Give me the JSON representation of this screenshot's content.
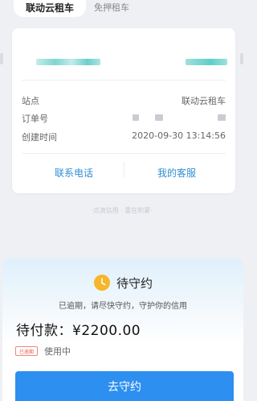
{
  "tabs": [
    {
      "label": "联动云租车"
    },
    {
      "label": "免押租车"
    }
  ],
  "order": {
    "rows": [
      {
        "label": "站点",
        "value": "联动云租车"
      },
      {
        "label": "订单号",
        "value": ""
      },
      {
        "label": "创建时间",
        "value": "2020-09-30 13:14:56"
      }
    ],
    "contact_label": "联系电话",
    "service_label": "我的客服"
  },
  "watermark": "·点滴信用 · 重在积累·",
  "pending": {
    "title": "待守约",
    "subtitle": "已逾期，请尽快守约，守护你的信用",
    "amount_label": "待付款：",
    "amount_value": "¥2200.00",
    "badge": "已逾期",
    "status": "使用中",
    "cta_label": "去守约"
  },
  "colors": {
    "accent": "#2d8ff0",
    "link": "#2f8fd4",
    "warning": "#f6b62a",
    "overdue": "#e8604f",
    "blur_teal": "#5fcfc9"
  },
  "icons": {
    "pending_status": "clock-icon"
  }
}
